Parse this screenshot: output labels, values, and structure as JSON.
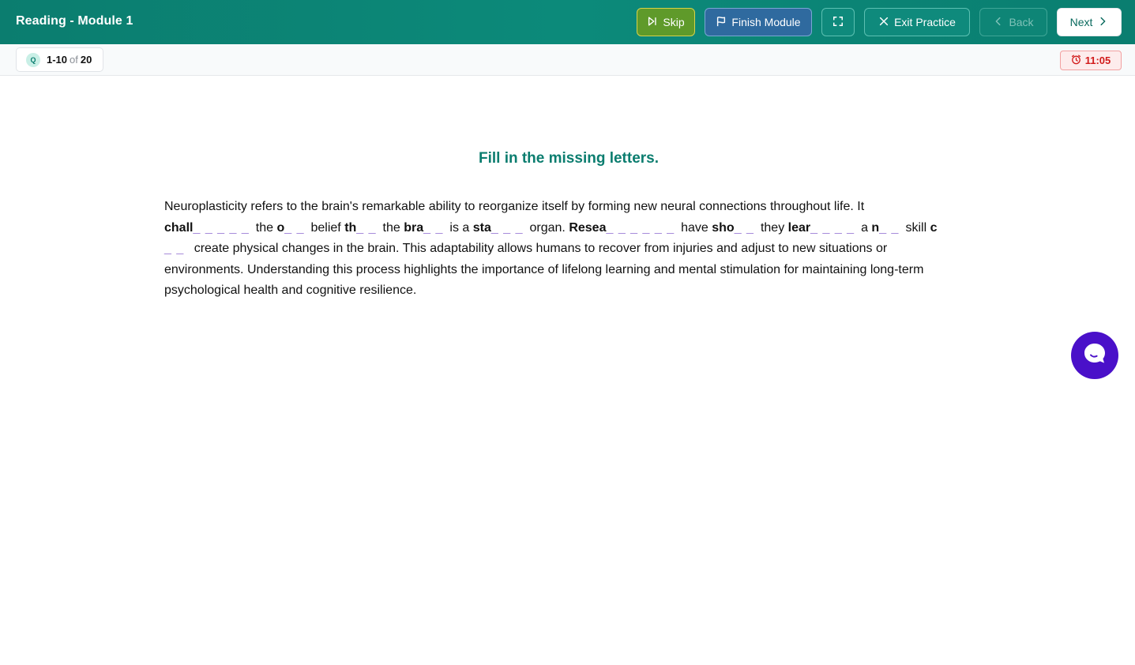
{
  "header": {
    "title": "Reading - Module 1",
    "skip_label": "Skip",
    "finish_label": "Finish Module",
    "exit_label": "Exit Practice",
    "back_label": "Back",
    "next_label": "Next"
  },
  "subbar": {
    "q_icon_letter": "Q",
    "range": "1-10",
    "of": "of",
    "total": "20",
    "timer": "11:05"
  },
  "main": {
    "instruction": "Fill in the missing letters.",
    "passage": {
      "intro": "Neuroplasticity refers to the brain's remarkable ability to reorganize itself by forming new neural connections throughout life. It",
      "items": [
        {
          "prefix": "chall",
          "blank": "_ _ _ _ _",
          "after": "the"
        },
        {
          "prefix": "o",
          "blank": "_ _",
          "after": "belief"
        },
        {
          "prefix": "th",
          "blank": "_ _",
          "after": "the"
        },
        {
          "prefix": "bra",
          "blank": "_ _",
          "after": "is a"
        },
        {
          "prefix": "sta",
          "blank": "_ _ _",
          "after": "organ."
        },
        {
          "prefix": "Resea",
          "blank": "_ _ _ _ _ _",
          "after": "have"
        },
        {
          "prefix": "sho",
          "blank": "_ _",
          "after": "they"
        },
        {
          "prefix": "lear",
          "blank": "_ _ _ _",
          "after": "a"
        },
        {
          "prefix": "n",
          "blank": "_ _",
          "after": "skill"
        },
        {
          "prefix": "c",
          "blank": "_ _",
          "after": ""
        }
      ],
      "outro": "create physical changes in the brain. This adaptability allows humans to recover from injuries and adjust to new situations or environments. Understanding this process highlights the importance of lifelong learning and mental stimulation for maintaining long-term psychological health and cognitive resilience."
    }
  },
  "colors": {
    "header_bg": "#0b7d6f",
    "accent": "#0b7d6f",
    "blank": "#a78bda",
    "timer": "#d11a1a",
    "chat": "#4a10c9"
  },
  "icons": {
    "skip": "skip-forward-icon",
    "finish": "flag-icon",
    "fullscreen": "fullscreen-icon",
    "exit": "close-icon",
    "back": "chevron-left-icon",
    "next": "chevron-right-icon",
    "timer": "clock-icon",
    "chat": "chat-bubble-icon"
  }
}
